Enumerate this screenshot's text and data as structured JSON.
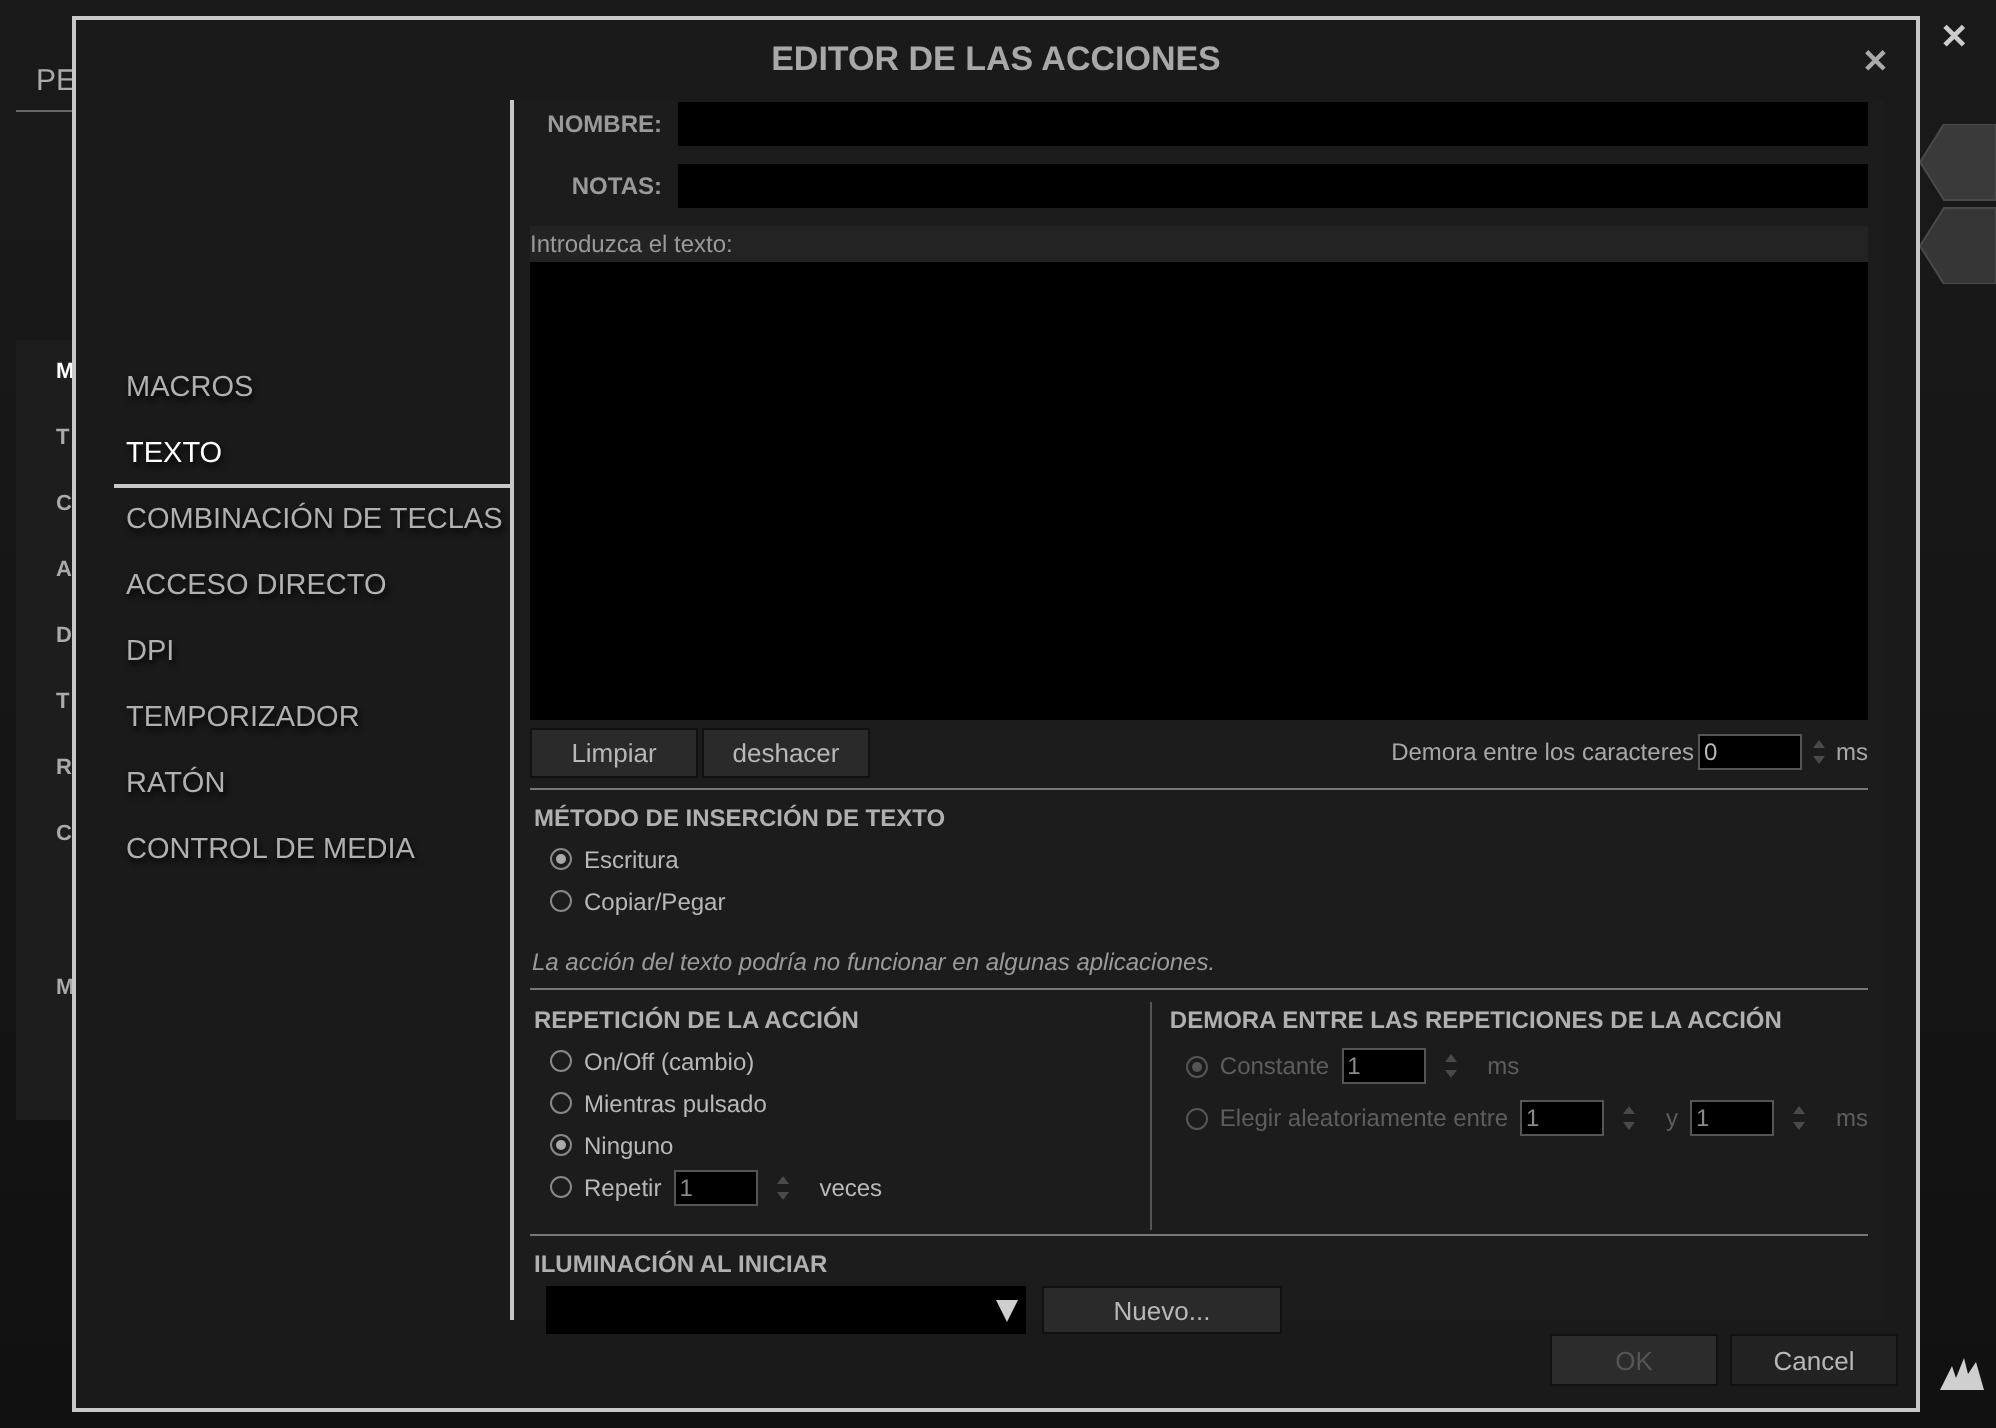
{
  "background_app": {
    "tab_fragment": "PE",
    "close": "✕",
    "list_fragments": [
      {
        "label": "M",
        "selected": true
      },
      {
        "label": "T",
        "selected": false
      },
      {
        "label": "C",
        "selected": false
      },
      {
        "label": "A",
        "selected": false
      },
      {
        "label": "D",
        "selected": false
      },
      {
        "label": "T",
        "selected": false
      },
      {
        "label": "R",
        "selected": false
      },
      {
        "label": "C",
        "selected": false
      },
      {
        "label": "M",
        "selected": false
      }
    ]
  },
  "dialog": {
    "title": "EDITOR DE LAS ACCIONES",
    "close": "✕"
  },
  "sidebar": {
    "items": [
      {
        "label": "MACROS",
        "selected": false
      },
      {
        "label": "TEXTO",
        "selected": true
      },
      {
        "label": "COMBINACIÓN DE TECLAS",
        "selected": false
      },
      {
        "label": "ACCESO DIRECTO",
        "selected": false
      },
      {
        "label": "DPI",
        "selected": false
      },
      {
        "label": "TEMPORIZADOR",
        "selected": false
      },
      {
        "label": "RATÓN",
        "selected": false
      },
      {
        "label": "CONTROL DE MEDIA",
        "selected": false
      }
    ]
  },
  "form": {
    "name_field": {
      "label": "NOMBRE:"
    },
    "notes_field": {
      "label": "NOTAS:"
    },
    "text_area": {
      "label": "Introduzca el texto:"
    },
    "buttons": [
      "Limpiar",
      "deshacer"
    ],
    "char_delay": {
      "label": "Demora entre los caracteres",
      "value": "0",
      "unit": "ms"
    },
    "insertion_method": {
      "heading": "MÉTODO DE INSERCIÓN DE TEXTO",
      "options": [
        {
          "label": "Escritura",
          "selected": true
        },
        {
          "label": "Copiar/Pegar",
          "selected": false
        }
      ]
    },
    "warning": "La acción del texto podría no funcionar en algunas aplicaciones.",
    "repetition": {
      "heading": "REPETICIÓN DE LA ACCIÓN",
      "options": [
        {
          "kind": "plain",
          "label": "On/Off (cambio)",
          "selected": false
        },
        {
          "kind": "plain",
          "label": "Mientras pulsado",
          "selected": false
        },
        {
          "kind": "plain",
          "label": "Ninguno",
          "selected": true
        },
        {
          "kind": "count",
          "label": "Repetir",
          "value": "1",
          "unit": "veces",
          "selected": false
        }
      ]
    },
    "repeat_delay": {
      "heading": "DEMORA ENTRE LAS REPETICIONES DE LA ACCIÓN",
      "options": [
        {
          "kind": "constant",
          "label": "Constante",
          "value": "1",
          "unit": "ms",
          "selected": true,
          "disabled": true
        },
        {
          "kind": "range",
          "label": "Elegir aleatoriamente entre",
          "value": "1",
          "joiner": "y",
          "value_2": "1",
          "unit": "ms",
          "selected": false,
          "disabled": true
        }
      ]
    },
    "lighting": {
      "heading": "ILUMINACIÓN AL INICIAR",
      "button": "Nuevo..."
    }
  },
  "footer": {
    "buttons": [
      {
        "label": "OK",
        "disabled": true
      },
      {
        "label": "Cancel",
        "disabled": false
      }
    ]
  }
}
